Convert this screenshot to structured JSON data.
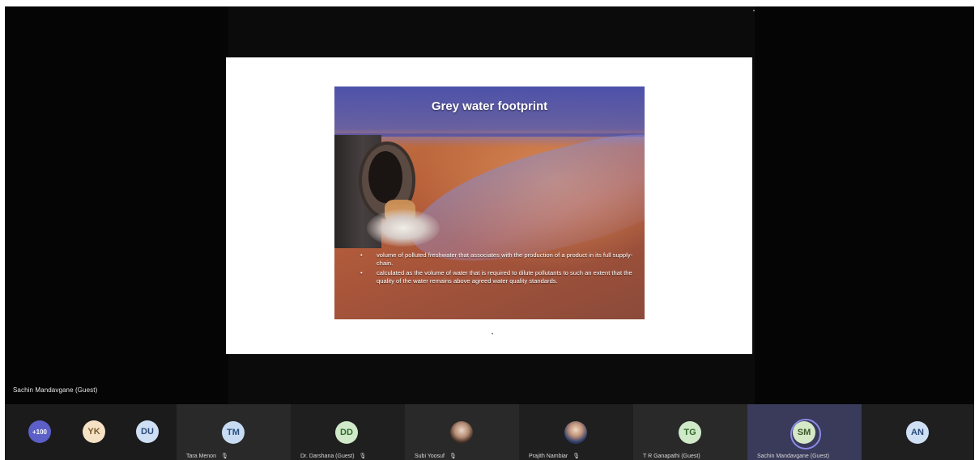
{
  "stage": {
    "presenter_label": "Sachin Mandavgane (Guest)"
  },
  "slide": {
    "title": "Grey water footprint",
    "bullets": [
      "volume of polluted freshwater that associates with the production of a product in its full supply-chain.",
      "calculated as the volume of water that is required to dilute pollutants to such an extent that the quality of the water remains above agreed water quality standards."
    ],
    "bullet_glyph": "•",
    "page_mark": "•"
  },
  "participants": {
    "overflow": {
      "label": "+100",
      "color": "#5b5fc7"
    },
    "compact": [
      {
        "initials": "YK",
        "color": "#f5e1c4",
        "text_color": "#7a5a2a"
      },
      {
        "initials": "DU",
        "color": "#cfe0f5",
        "text_color": "#2a4a7a"
      }
    ],
    "tiles": [
      {
        "initials": "TM",
        "name": "Tara Menon",
        "color": "#c7dcf3",
        "text_color": "#2c4f7c",
        "mic": "🎙"
      },
      {
        "initials": "DD",
        "name": "Dr. Darshana (Guest)",
        "color": "#cfe9c9",
        "text_color": "#2f6a2a",
        "mic": "🎙"
      },
      {
        "initials": "",
        "name": "Subi Yoosuf",
        "color": "",
        "text_color": "",
        "mic": "🎙"
      },
      {
        "initials": "",
        "name": "Prajith Nambiar",
        "color": "",
        "text_color": "",
        "mic": "🎙"
      },
      {
        "initials": "TG",
        "name": "T R Ganapathi (Guest)",
        "color": "#cfe9c9",
        "text_color": "#2f6a2a",
        "mic": ""
      },
      {
        "initials": "SM",
        "name": "Sachin Mandavgane (Guest)",
        "color": "#d5e8c7",
        "text_color": "#3a5a2a",
        "mic": ""
      },
      {
        "initials": "AN",
        "name": "",
        "color": "#cfe0f5",
        "text_color": "#2a4a7a",
        "mic": ""
      }
    ]
  }
}
